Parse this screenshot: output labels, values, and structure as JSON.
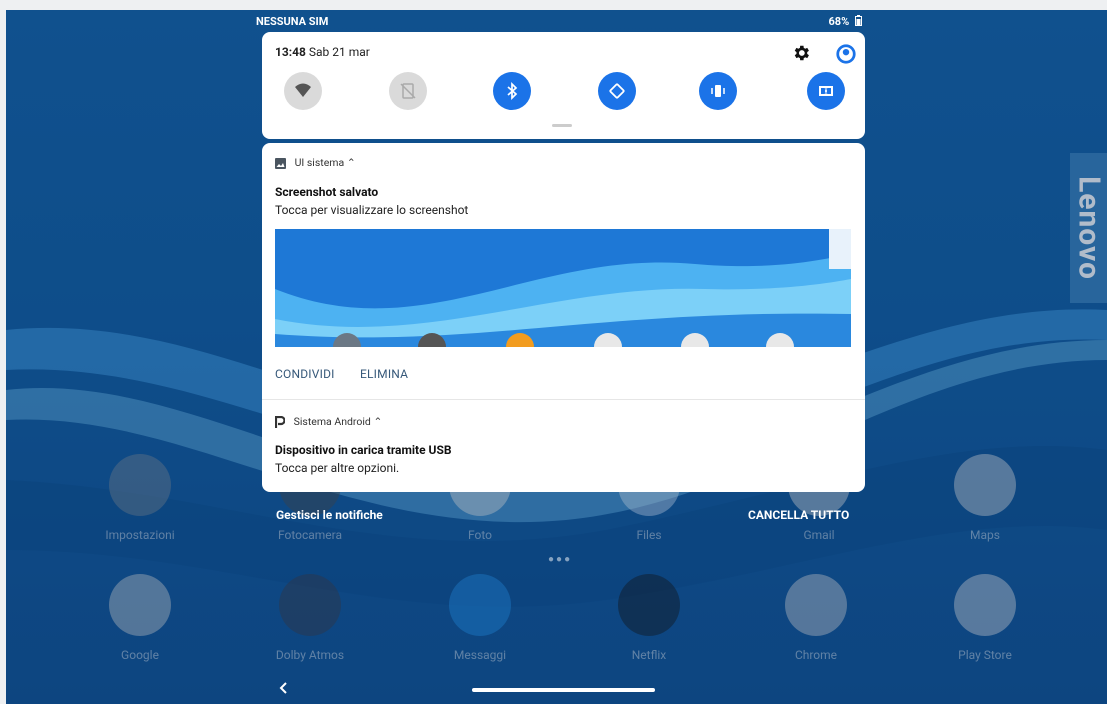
{
  "status_bar": {
    "carrier": "NESSUNA SIM",
    "battery": "68%"
  },
  "quick_settings": {
    "time": "13:48",
    "date": "Sab 21 mar",
    "tiles": [
      {
        "name": "wifi",
        "state": "off"
      },
      {
        "name": "mobile-data",
        "state": "off"
      },
      {
        "name": "bluetooth",
        "state": "on"
      },
      {
        "name": "auto-rotate",
        "state": "on"
      },
      {
        "name": "vibrate",
        "state": "on"
      },
      {
        "name": "dolby",
        "state": "on"
      }
    ]
  },
  "notifications": [
    {
      "app": "UI sistema",
      "title": "Screenshot salvato",
      "text": "Tocca per visualizzare lo screenshot",
      "actions": [
        "CONDIVIDI",
        "ELIMINA"
      ]
    },
    {
      "app": "Sistema Android",
      "title": "Dispositivo in carica tramite USB",
      "text": "Tocca per altre opzioni."
    }
  ],
  "footer": {
    "manage": "Gestisci le notifiche",
    "clear_all": "CANCELLA TUTTO"
  },
  "wallpaper_brand": "Lenovo",
  "home_apps": [
    [
      "Impostazioni",
      "Fotocamera",
      "Foto",
      "Files",
      "Gmail",
      "Maps"
    ],
    [
      "Google",
      "Dolby Atmos",
      "Messaggi",
      "Netflix",
      "Chrome",
      "Play Store"
    ]
  ],
  "colors": {
    "accent": "#1b73e8",
    "wallpaper": "#0d5aa0",
    "netflix": "#e50914"
  }
}
